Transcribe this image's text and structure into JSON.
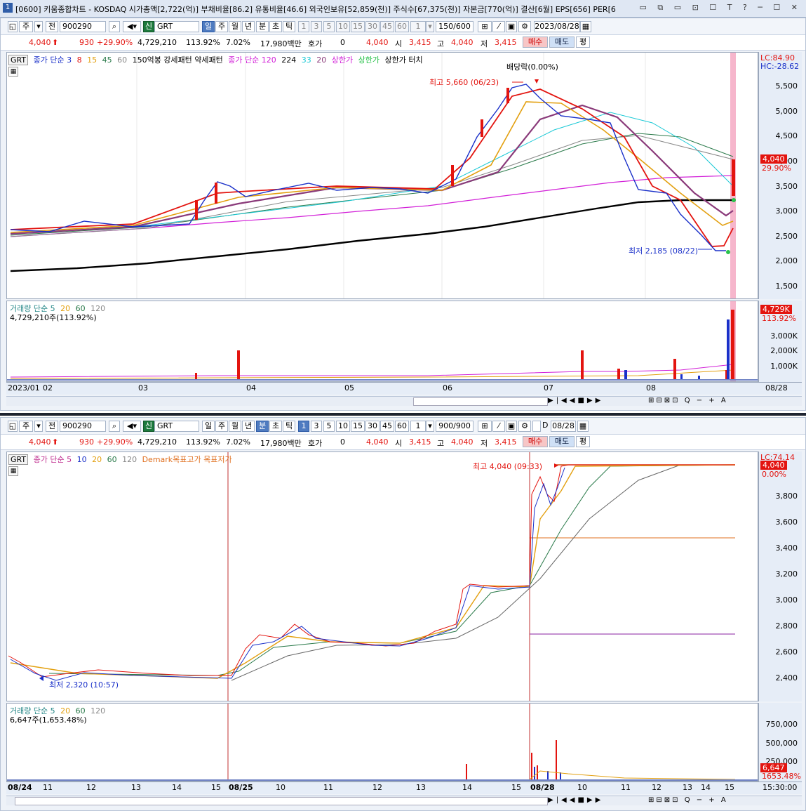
{
  "window": {
    "icon": "1",
    "title": "[0600] 키움종합차트 - KOSDAQ 시가총액[2,722(억)] 부채비율[86.2] 유통비율[46.6] 외국인보유[52,859(천)] 주식수[67,375(천)] 자본금[770(억)] 결산[6월] EPS[656] PER[6",
    "controls": "▭ ⧉ ▭ ⊡ ☐ T ?  ─ ☐ ✕"
  },
  "top": {
    "toolbar": {
      "period_btn": "주",
      "range_btn": "전",
      "code": "900290",
      "name_badge": "신",
      "name": "GRT",
      "periods": [
        "일",
        "주",
        "월",
        "년",
        "분",
        "초",
        "틱"
      ],
      "active_period": "일",
      "minutes": [
        "1",
        "3",
        "5",
        "10",
        "15",
        "30",
        "45",
        "60"
      ],
      "count_sel": "1",
      "bars": "150/600",
      "date": "2023/08/28"
    },
    "info": {
      "price": "4,040",
      "change": "930",
      "rate": "+29.90%",
      "volume": "4,729,210",
      "vol_ratio": "113.92%",
      "turnover": "7.02%",
      "amount": "17,980백만",
      "quote_label": "호가",
      "quote": "0",
      "price2": "4,040",
      "open_label": "시",
      "open": "3,415",
      "high_label": "고",
      "high": "4,040",
      "low_label": "저",
      "low": "3,415",
      "buy": "매수",
      "sell": "매도",
      "eval": "평"
    },
    "legend": {
      "code_tag": "GRT",
      "ma_label": "종가 단순 3",
      "ma_periods": [
        "8",
        "15",
        "45",
        "60"
      ],
      "extra": "150억봉 강세패턴  약세패턴",
      "ma2_label": "종가 단순 120",
      "ma2_periods": [
        "224",
        "33",
        "20"
      ],
      "limit_up": "상한가",
      "limit_up2": "상한가",
      "limit_touch": "상한가 터치"
    },
    "right_labels": {
      "lc": "LC:84.90",
      "hc": "HC:-28.62",
      "price_box": "4,040",
      "rate_box": "29.90%"
    },
    "annot": {
      "high": "최고 5,660 (06/23)",
      "dividend": "배당락(0.00%)",
      "low": "최저 2,185 (08/22)"
    },
    "yticks": [
      "5,500",
      "5,000",
      "4,500",
      "4,000",
      "3,500",
      "3,000",
      "2,500",
      "2,000",
      "1,500"
    ],
    "vol_legend": {
      "label": "거래량 단순 5",
      "periods": [
        "20",
        "60",
        "120"
      ],
      "value": "4,729,210주(113.92%)"
    },
    "vol_box": {
      "value": "4,729K",
      "rate": "113.92%"
    },
    "vol_ticks": [
      "3,000K",
      "2,000K",
      "1,000K"
    ],
    "xticks": [
      "2023/01",
      "02",
      "03",
      "04",
      "05",
      "06",
      "07",
      "08"
    ],
    "xlast": "08/28"
  },
  "bottom": {
    "toolbar": {
      "period_btn": "주",
      "range_btn": "전",
      "code": "900290",
      "name_badge": "신",
      "name": "GRT",
      "periods": [
        "일",
        "주",
        "월",
        "년",
        "분",
        "초",
        "틱"
      ],
      "active_period": "분",
      "minutes": [
        "1",
        "3",
        "5",
        "10",
        "15",
        "30",
        "45",
        "60"
      ],
      "active_minute": "1",
      "count_sel": "1",
      "bars": "900/900",
      "d_label": "D",
      "date": "08/28"
    },
    "info": {
      "price": "4,040",
      "change": "930",
      "rate": "+29.90%",
      "volume": "4,729,210",
      "vol_ratio": "113.92%",
      "turnover": "7.02%",
      "amount": "17,980백만",
      "quote_label": "호가",
      "quote": "0",
      "price2": "4,040",
      "open_label": "시",
      "open": "3,415",
      "high_label": "고",
      "high": "4,040",
      "low_label": "저",
      "low": "3,415",
      "buy": "매수",
      "sell": "매도",
      "eval": "평"
    },
    "legend": {
      "code_tag": "GRT",
      "ma_label": "종가 단순 5",
      "ma_periods": [
        "10",
        "20",
        "60",
        "120"
      ],
      "demark": "Demark목표고가 목표저가"
    },
    "right_labels": {
      "lc": "LC:74.14",
      "price_box": "4,040",
      "rate_box": "0.00%"
    },
    "annot": {
      "high": "최고 4,040 (09:33)",
      "low": "최저 2,320 (10:57)"
    },
    "yticks": [
      "3,800",
      "3,600",
      "3,400",
      "3,200",
      "3,000",
      "2,800",
      "2,600",
      "2,400"
    ],
    "vol_legend": {
      "label": "거래량 단순 5",
      "periods": [
        "20",
        "60",
        "120"
      ],
      "value": "6,647주(1,653.48%)"
    },
    "vol_box": {
      "value": "6,647",
      "rate": "1653.48%"
    },
    "vol_ticks": [
      "750,000",
      "500,000",
      "250,000"
    ],
    "xticks": [
      "08/24",
      "11",
      "12",
      "13",
      "14",
      "15",
      "08/25",
      "10",
      "11",
      "12",
      "13",
      "14",
      "15",
      "08/28",
      "10",
      "11",
      "12",
      "13",
      "14",
      "15"
    ],
    "xlast": "15:30:00"
  },
  "colors": {
    "up": "#e3140f",
    "down": "#1a30c9",
    "limit": "#f6b6cc",
    "bg_axis": "#e6edf7"
  }
}
